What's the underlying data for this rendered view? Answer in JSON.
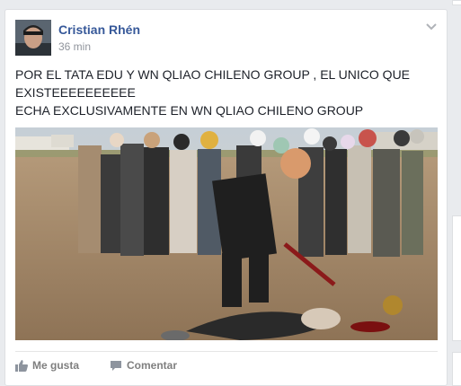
{
  "post": {
    "author": "Cristian Rhén",
    "time": "36 min",
    "text_lines": [
      "POR EL TATA EDU Y WN QLIAO CHILENO GROUP , EL UNICO QUE",
      "EXISTEEEEEEEEEE",
      "ECHA EXCLUSIVAMENTE EN WN QLIAO CHILENO GROUP"
    ],
    "photo_icon": "photo-image",
    "menu_icon": "chevron-down-icon"
  },
  "actions": {
    "like_label": "Me gusta",
    "like_icon": "thumbs-up-icon",
    "comment_label": "Comentar",
    "comment_icon": "comment-icon"
  },
  "colors": {
    "link": "#365899",
    "meta": "#90949c",
    "text": "#1d2129",
    "action": "#7f7f7f",
    "background": "#e9ebee"
  }
}
